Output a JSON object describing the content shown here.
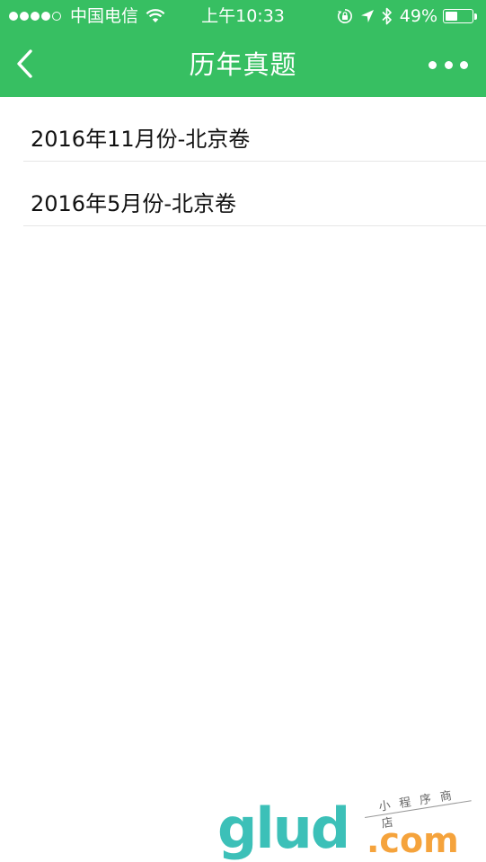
{
  "status_bar": {
    "carrier": "中国电信",
    "time": "上午10:33",
    "battery_percent": "49%",
    "battery_level": 0.49,
    "signal_bars_filled": 4,
    "signal_bars_total": 5
  },
  "nav": {
    "title": "历年真题"
  },
  "list": {
    "items": [
      {
        "label": "2016年11月份-北京卷"
      },
      {
        "label": "2016年5月份-北京卷"
      }
    ]
  },
  "watermark": {
    "brand": "glud",
    "domain": ".com",
    "tagline": "小程序商店"
  },
  "colors": {
    "header_green": "#37bf62",
    "watermark_teal": "#3cc0b8",
    "watermark_orange": "#f5a33c"
  },
  "icons": {
    "back": "chevron-left-icon",
    "more": "more-dots-icon",
    "wifi": "wifi-icon",
    "lock_rotation": "rotation-lock-icon",
    "location": "location-arrow-icon",
    "bluetooth": "bluetooth-icon",
    "battery": "battery-icon"
  }
}
